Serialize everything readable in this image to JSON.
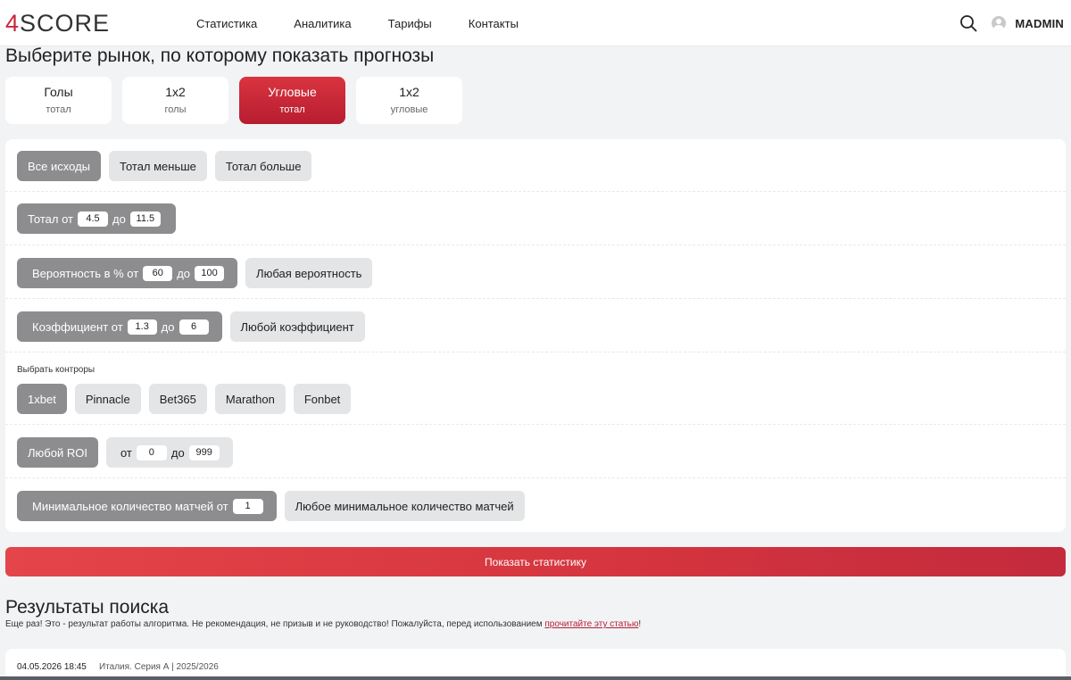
{
  "header": {
    "logo_prefix": "4",
    "logo_rest": "SCORE",
    "nav": [
      "Статистика",
      "Аналитика",
      "Тарифы",
      "Контакты"
    ],
    "username": "MADMIN"
  },
  "page_title": "Выберите рынок, по которому показать прогнозы",
  "markets": [
    {
      "title": "Голы",
      "sub": "тотал",
      "active": false
    },
    {
      "title": "1x2",
      "sub": "голы",
      "active": false
    },
    {
      "title": "Угловые",
      "sub": "тотал",
      "active": true
    },
    {
      "title": "1x2",
      "sub": "угловые",
      "active": false
    }
  ],
  "filters": {
    "outcomes": {
      "all": "Все исходы",
      "under": "Тотал меньше",
      "over": "Тотал больше"
    },
    "total": {
      "from_label": "Тотал от",
      "from_value": "4.5",
      "to_label": "до",
      "to_value": "11.5"
    },
    "probability": {
      "from_label": "Вероятность в % от",
      "from_value": "60",
      "to_label": "до",
      "to_value": "100",
      "any_label": "Любая вероятность"
    },
    "coefficient": {
      "from_label": "Коэффициент от",
      "from_value": "1.3",
      "to_label": "до",
      "to_value": "6",
      "any_label": "Любой коэффициент"
    },
    "bookmakers": {
      "label": "Выбрать контроры",
      "items": [
        "1xbet",
        "Pinnacle",
        "Bet365",
        "Marathon",
        "Fonbet"
      ]
    },
    "roi": {
      "any_label": "Любой ROI",
      "from_label": "от",
      "from_value": "0",
      "to_label": "до",
      "to_value": "999"
    },
    "min_matches": {
      "label": "Минимальное количество матчей от",
      "value": "1",
      "any_label": "Любое минимальное количество матчей"
    }
  },
  "show_button": "Показать статистику",
  "results": {
    "title": "Результаты поиска",
    "disclaimer_text": "Еще раз! Это - результат работы алгоритма. Не рекомендация, не призыв и не руководство! Пожалуйста, перед использованием ",
    "disclaimer_link": "прочитайте эту статью",
    "disclaimer_end": "!",
    "first_row": {
      "datetime": "04.05.2026 18:45",
      "league": "Италия. Серия А | 2025/2026"
    }
  },
  "colors": {
    "accent": "#c7283a",
    "pill_dark": "#8d8d8f",
    "pill_light": "#e4e5e7",
    "background": "#f2f3f5"
  }
}
